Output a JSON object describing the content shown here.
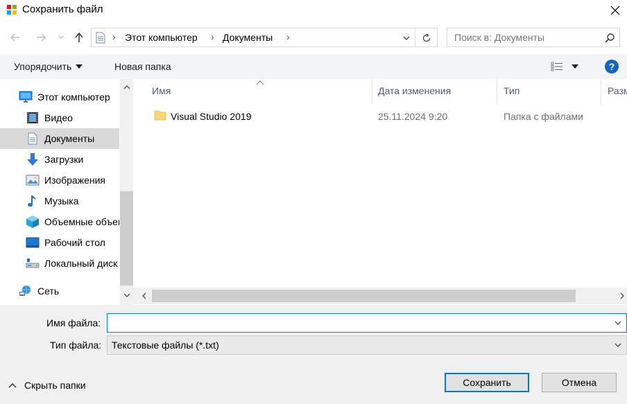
{
  "window": {
    "title": "Сохранить файл",
    "close_icon": "close-icon",
    "app_icon": "app-icon"
  },
  "nav": {
    "back_icon": "arrow-left-icon",
    "forward_icon": "arrow-right-icon",
    "recent_icon": "chevron-down-icon",
    "up_icon": "arrow-up-icon"
  },
  "address": {
    "crumbs": [
      "Этот компьютер",
      "Документы"
    ],
    "location_icon": "document-icon",
    "dropdown_icon": "chevron-down-icon",
    "refresh_icon": "refresh-icon"
  },
  "search": {
    "placeholder": "Поиск в: Документы",
    "icon": "search-icon"
  },
  "toolbar": {
    "organize_label": "Упорядочить",
    "new_folder_label": "Новая папка",
    "view_icon": "view-details-icon",
    "help_icon": "help-icon"
  },
  "sidebar": {
    "items": [
      {
        "label": "Этот компьютер",
        "icon": "computer-icon",
        "level": "top"
      },
      {
        "label": "Видео",
        "icon": "video-icon",
        "level": "child"
      },
      {
        "label": "Документы",
        "icon": "document-icon",
        "level": "child",
        "selected": true
      },
      {
        "label": "Загрузки",
        "icon": "download-icon",
        "level": "child"
      },
      {
        "label": "Изображения",
        "icon": "pictures-icon",
        "level": "child"
      },
      {
        "label": "Музыка",
        "icon": "music-icon",
        "level": "child"
      },
      {
        "label": "Объемные объекты",
        "icon": "3d-objects-icon",
        "level": "child"
      },
      {
        "label": "Рабочий стол",
        "icon": "desktop-icon",
        "level": "child"
      },
      {
        "label": "Локальный диск",
        "icon": "drive-icon",
        "level": "child"
      },
      {
        "label": "Сеть",
        "icon": "network-icon",
        "level": "top"
      }
    ]
  },
  "columns": {
    "name": "Имя",
    "date": "Дата изменения",
    "type": "Тип",
    "size": "Размер"
  },
  "files": [
    {
      "name": "Visual Studio 2019",
      "date": "25.11.2024 9:20",
      "type": "Папка с файлами",
      "icon": "folder-icon"
    }
  ],
  "form": {
    "filename_label": "Имя файла:",
    "filename_value": "",
    "filetype_label": "Тип файла:",
    "filetype_value": "Текстовые файлы (*.txt)",
    "hide_folders_label": "Скрыть папки",
    "save_label": "Сохранить",
    "cancel_label": "Отмена"
  },
  "colors": {
    "accent": "#0078d7",
    "selected_bg": "#d9d9d9",
    "toolbar_bg": "#f3f4f6",
    "header_text": "#4c607a",
    "folder": "#f8d775"
  }
}
